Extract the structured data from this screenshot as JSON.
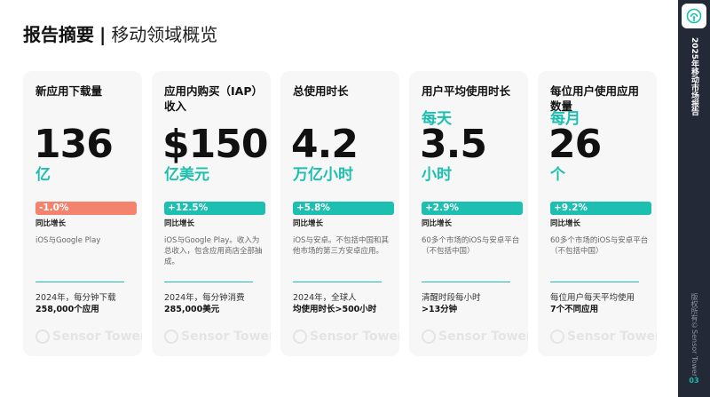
{
  "header": {
    "title_main": "报告摘要",
    "separator": "|",
    "title_sub": "移动领域概览"
  },
  "colors": {
    "accent_teal": "#1dbfb1",
    "negative_coral": "#f4836e",
    "sidebar_bg": "#232936",
    "card_bg": "#f7f7f7"
  },
  "cards": [
    {
      "label": "新应用下载量",
      "prefix": "",
      "value": "136",
      "unit": "亿",
      "change": "-1.0%",
      "change_direction": "negative",
      "change_label": "同比增长",
      "note": "iOS与Google Play",
      "footer_line1": "2024年，每分钟下载",
      "footer_line2": "258,000个应用",
      "watermark": "Sensor Tower"
    },
    {
      "label": "应用内购买（IAP）收入",
      "prefix": "",
      "value": "$150",
      "unit": "亿美元",
      "change": "+12.5%",
      "change_direction": "positive",
      "change_label": "同比增长",
      "note": "iOS与Google Play。收入为总收入，包含应用商店全部抽成。",
      "footer_line1": "2024年，每分钟消费",
      "footer_line2": "285,000美元",
      "watermark": "Sensor Tower"
    },
    {
      "label": "总使用时长",
      "prefix": "",
      "value": "4.2",
      "unit": "万亿小时",
      "change": "+5.8%",
      "change_direction": "positive",
      "change_label": "同比增长",
      "note": "iOS与安卓。不包括中国和其他市场的第三方安卓应用。",
      "footer_line1": "2024年，全球人",
      "footer_line2": "均使用时长>500小时",
      "watermark": "Sensor Tower"
    },
    {
      "label": "用户平均使用时长",
      "prefix": "每天",
      "value": "3.5",
      "unit": "小时",
      "change": "+2.9%",
      "change_direction": "positive",
      "change_label": "同比增长",
      "note": "60多个市场的iOS与安卓平台（不包括中国）",
      "footer_line1": "清醒时段每小时",
      "footer_line2": ">13分钟",
      "watermark": "Sensor Tower"
    },
    {
      "label": "每位用户使用应用数量",
      "prefix": "每月",
      "value": "26",
      "unit": "个",
      "change": "+9.2%",
      "change_direction": "positive",
      "change_label": "同比增长",
      "note": "60多个市场的iOS与安卓平台（不包括中国）",
      "footer_line1": "每位用户每天平均使用",
      "footer_line2": "7个不同应用",
      "watermark": "Sensor Tower"
    }
  ],
  "sidebar": {
    "logo_icon": "sensor-tower-logo-icon",
    "report_title": "2025年移动市场报告",
    "copyright": "版权所有©Sensor Tower",
    "page_number": "03"
  }
}
